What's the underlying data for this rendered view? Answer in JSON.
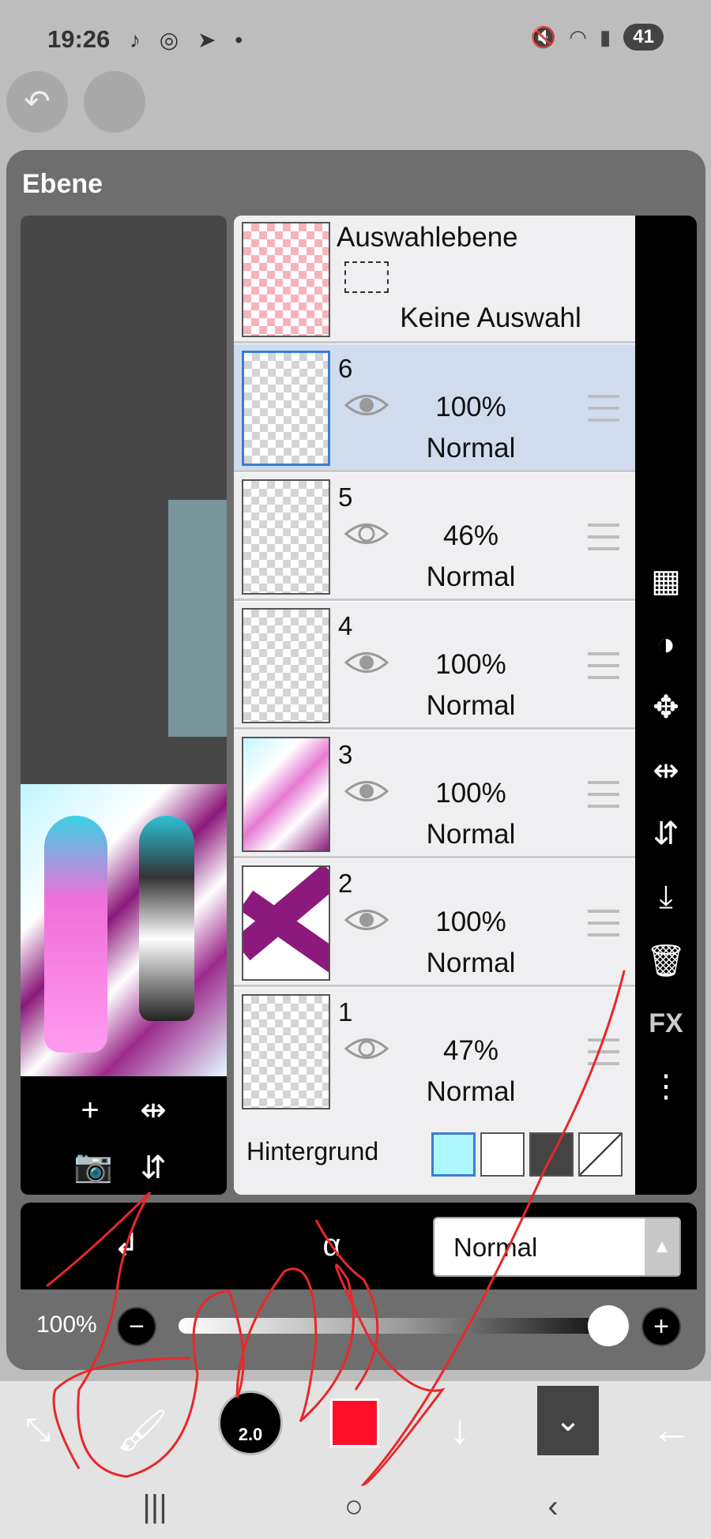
{
  "status_bar": {
    "time": "19:26",
    "battery": "41"
  },
  "panel": {
    "title": "Ebene"
  },
  "selection_layer": {
    "title": "Auswahlebene",
    "state": "Keine Auswahl"
  },
  "layers": [
    {
      "number": "6",
      "opacity": "100%",
      "blend": "Normal",
      "visible": true,
      "selected": true
    },
    {
      "number": "5",
      "opacity": "46%",
      "blend": "Normal",
      "visible": false,
      "selected": false
    },
    {
      "number": "4",
      "opacity": "100%",
      "blend": "Normal",
      "visible": true,
      "selected": false
    },
    {
      "number": "3",
      "opacity": "100%",
      "blend": "Normal",
      "visible": true,
      "selected": false
    },
    {
      "number": "2",
      "opacity": "100%",
      "blend": "Normal",
      "visible": true,
      "selected": false
    },
    {
      "number": "1",
      "opacity": "47%",
      "blend": "Normal",
      "visible": false,
      "selected": false
    }
  ],
  "background": {
    "label": "Hintergrund",
    "options": [
      "light-blue",
      "checker-light",
      "checker-dark",
      "none"
    ],
    "selected": "light-blue"
  },
  "side_tools": {
    "fx_label": "FX"
  },
  "blend_mode": {
    "value": "Normal"
  },
  "opacity_control": {
    "label": "100%",
    "value": 1.0
  },
  "toolbar": {
    "brush_size": "2.0",
    "color": "#ff1028"
  },
  "colors": {
    "accent": "#3b7bd9",
    "scribble": "#e8282a"
  }
}
